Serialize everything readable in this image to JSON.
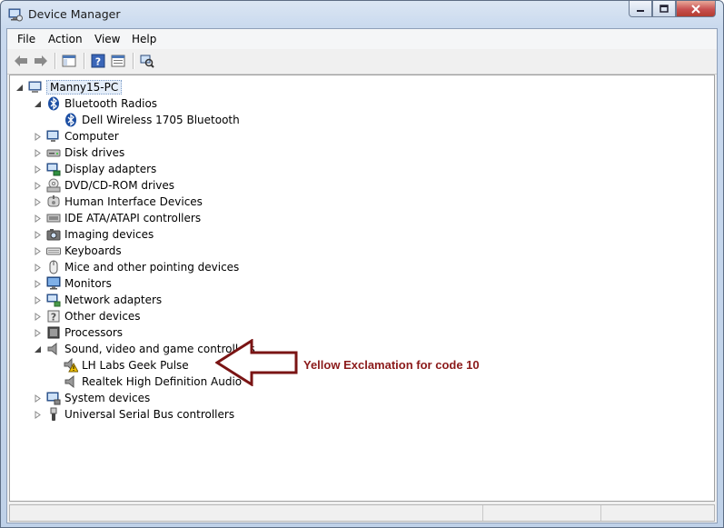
{
  "window": {
    "title": "Device Manager",
    "minimize_icon": "minimize-icon",
    "maximize_icon": "maximize-icon",
    "close_icon": "close-icon"
  },
  "menu": [
    "File",
    "Action",
    "View",
    "Help"
  ],
  "toolbar": {
    "buttons": [
      "back-arrow-icon",
      "forward-arrow-icon",
      "show-hide-console-tree-icon",
      "help-icon",
      "properties-icon",
      "scan-hardware-icon"
    ]
  },
  "tree": {
    "root": "Manny15-PC",
    "categories": [
      {
        "label": "Bluetooth Radios",
        "icon": "bluetooth-icon",
        "expanded": true,
        "children": [
          {
            "label": "Dell Wireless 1705 Bluetooth",
            "icon": "bluetooth-icon"
          }
        ]
      },
      {
        "label": "Computer",
        "icon": "computer-icon"
      },
      {
        "label": "Disk drives",
        "icon": "disk-drive-icon"
      },
      {
        "label": "Display adapters",
        "icon": "display-adapter-icon"
      },
      {
        "label": "DVD/CD-ROM drives",
        "icon": "dvd-drive-icon"
      },
      {
        "label": "Human Interface Devices",
        "icon": "hid-icon"
      },
      {
        "label": "IDE ATA/ATAPI controllers",
        "icon": "ide-controller-icon"
      },
      {
        "label": "Imaging devices",
        "icon": "camera-icon"
      },
      {
        "label": "Keyboards",
        "icon": "keyboard-icon"
      },
      {
        "label": "Mice and other pointing devices",
        "icon": "mouse-icon"
      },
      {
        "label": "Monitors",
        "icon": "monitor-icon"
      },
      {
        "label": "Network adapters",
        "icon": "network-adapter-icon"
      },
      {
        "label": "Other devices",
        "icon": "other-devices-icon"
      },
      {
        "label": "Processors",
        "icon": "processor-icon"
      },
      {
        "label": "Sound, video and game controllers",
        "icon": "speaker-icon",
        "expanded": true,
        "children": [
          {
            "label": "LH Labs Geek Pulse",
            "icon": "speaker-warning-icon",
            "warning": true
          },
          {
            "label": "Realtek High Definition Audio",
            "icon": "speaker-icon"
          }
        ]
      },
      {
        "label": "System devices",
        "icon": "system-devices-icon"
      },
      {
        "label": "Universal Serial Bus controllers",
        "icon": "usb-icon"
      }
    ]
  },
  "annotation": {
    "text": "Yellow Exclamation for code 10",
    "color": "#8b1a1a"
  },
  "colors": {
    "warning": "#f2c200",
    "selection_bg": "#e5eef9"
  }
}
